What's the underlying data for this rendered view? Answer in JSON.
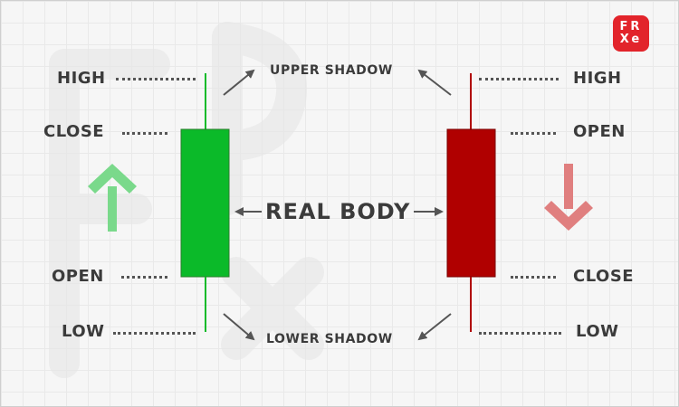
{
  "logo": {
    "line1": "FR",
    "line2": "Xe",
    "color": "#e2242b"
  },
  "bullish": {
    "color": "#0bba29",
    "arrow_color": "#7ad98b",
    "arrow_icon": "arrow-up",
    "labels": {
      "high": "HIGH",
      "close": "CLOSE",
      "open": "OPEN",
      "low": "LOW"
    }
  },
  "bearish": {
    "color": "#b00000",
    "arrow_color": "#e07f7f",
    "arrow_icon": "arrow-down",
    "labels": {
      "high": "HIGH",
      "open": "OPEN",
      "close": "CLOSE",
      "low": "LOW"
    }
  },
  "center": {
    "upper_shadow": "UPPER SHADOW",
    "real_body": "REAL BODY",
    "lower_shadow": "LOWER SHADOW"
  },
  "colors": {
    "text": "#3b3b3b",
    "arrows": "#555555"
  }
}
